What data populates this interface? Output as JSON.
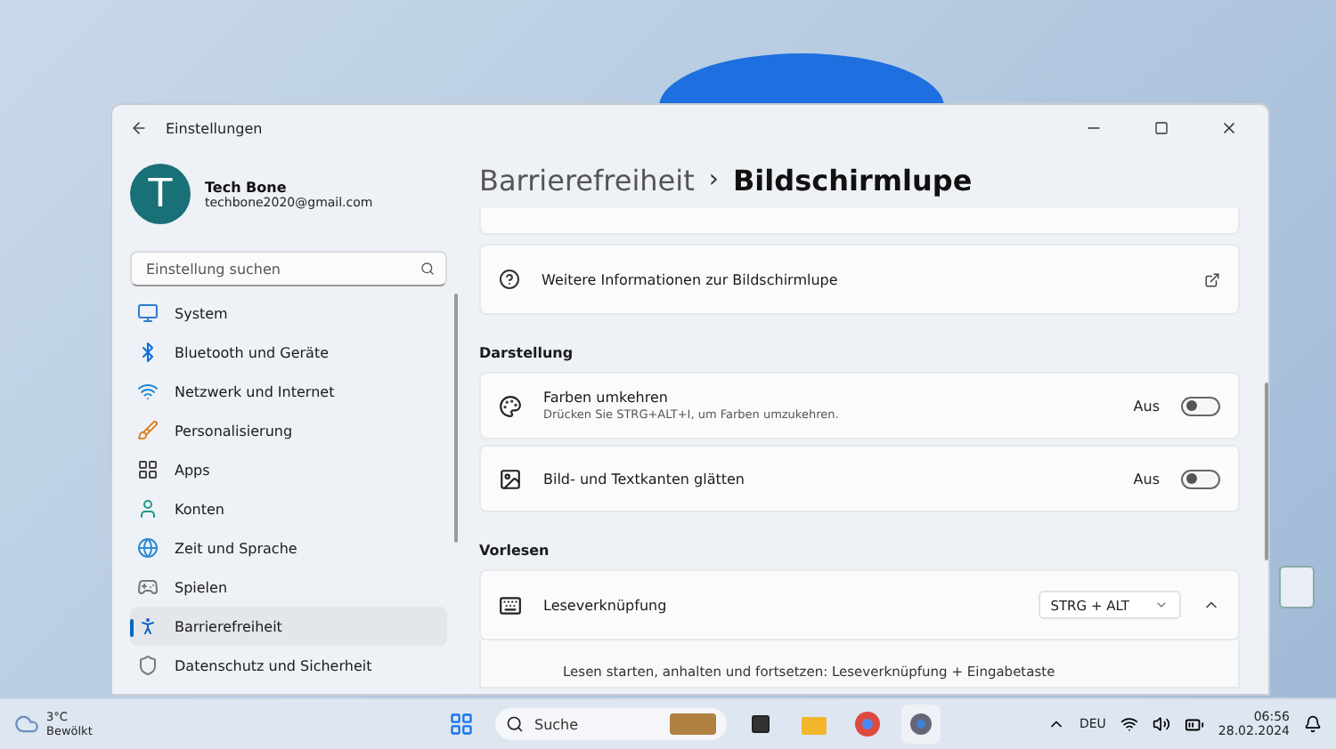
{
  "window": {
    "title": "Einstellungen"
  },
  "profile": {
    "name": "Tech Bone",
    "email": "techbone2020@gmail.com",
    "initial": "T"
  },
  "search": {
    "placeholder": "Einstellung suchen"
  },
  "sidebar": {
    "items": [
      {
        "label": "System",
        "selected": false
      },
      {
        "label": "Bluetooth und Geräte",
        "selected": false
      },
      {
        "label": "Netzwerk und Internet",
        "selected": false
      },
      {
        "label": "Personalisierung",
        "selected": false
      },
      {
        "label": "Apps",
        "selected": false
      },
      {
        "label": "Konten",
        "selected": false
      },
      {
        "label": "Zeit und Sprache",
        "selected": false
      },
      {
        "label": "Spielen",
        "selected": false
      },
      {
        "label": "Barrierefreiheit",
        "selected": true
      },
      {
        "label": "Datenschutz und Sicherheit",
        "selected": false
      }
    ]
  },
  "breadcrumb": {
    "parent": "Barrierefreiheit",
    "separator": "›",
    "current": "Bildschirmlupe"
  },
  "info_link": {
    "label": "Weitere Informationen zur Bildschirmlupe"
  },
  "sections": [
    {
      "title": "Darstellung",
      "rows": [
        {
          "kind": "toggle",
          "title": "Farben umkehren",
          "subtitle": "Drücken Sie STRG+ALT+I, um Farben umzukehren.",
          "state": "Aus",
          "on": false
        },
        {
          "kind": "toggle",
          "title": "Bild- und Textkanten glätten",
          "state": "Aus",
          "on": false
        }
      ]
    },
    {
      "title": "Vorlesen",
      "rows": [
        {
          "kind": "dropdown",
          "title": "Leseverknüpfung",
          "value": "STRG + ALT",
          "expanded": true,
          "detail": "Lesen starten, anhalten und fortsetzen: Leseverknüpfung + Eingabetaste"
        }
      ]
    }
  ],
  "taskbar": {
    "weather": {
      "temp": "3°C",
      "condition": "Bewölkt"
    },
    "search": "Suche",
    "language": "DEU",
    "time": "06:56",
    "date": "28.02.2024"
  }
}
